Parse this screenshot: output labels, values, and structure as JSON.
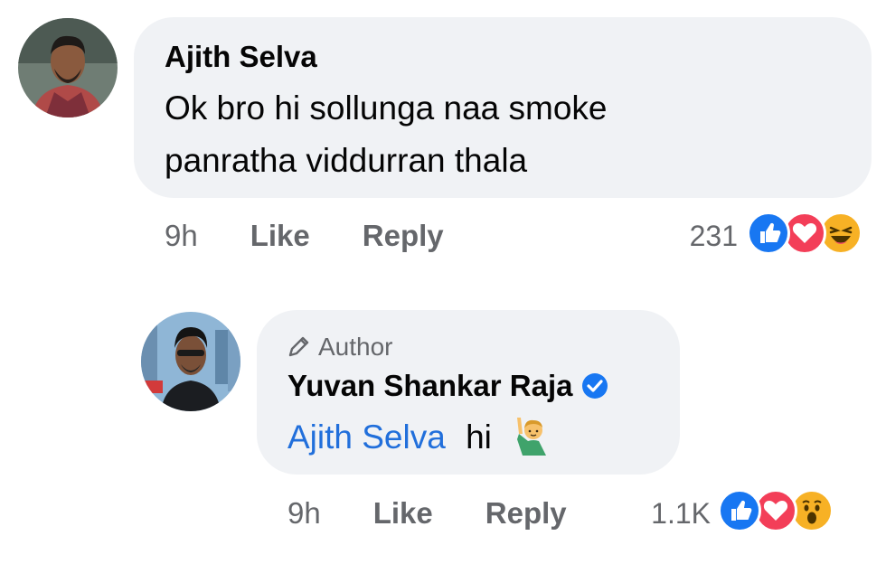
{
  "comment": {
    "author": "Ajith Selva",
    "text": "Ok bro hi sollunga naa smoke panratha viddurran thala",
    "time": "9h",
    "like_label": "Like",
    "reply_label": "Reply",
    "reaction_count": "231",
    "reactions": [
      "like-icon",
      "love-icon",
      "haha-icon"
    ]
  },
  "reply": {
    "badge": "Author",
    "author": "Yuvan Shankar Raja",
    "mention": "Ajith Selva",
    "text": "hi",
    "emoji": "raising-hand-icon",
    "time": "9h",
    "like_label": "Like",
    "reply_label": "Reply",
    "reaction_count": "1.1K",
    "reactions": [
      "like-icon",
      "love-icon",
      "wow-icon"
    ]
  },
  "colors": {
    "bubble": "#f0f2f5",
    "meta": "#65676b",
    "mention": "#216fdb",
    "like": "#1877f2",
    "love": "#f33e58",
    "emoji_yellow": "#f7b125"
  }
}
